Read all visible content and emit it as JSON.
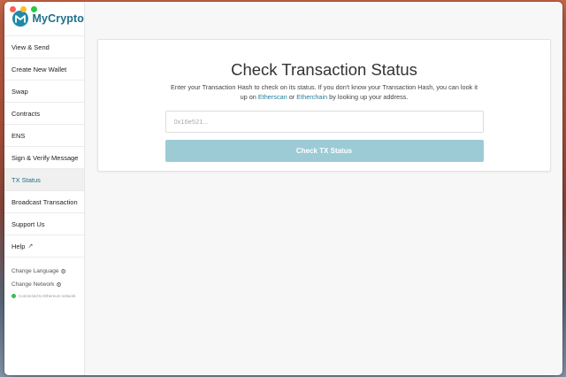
{
  "app": {
    "brand_name": "MyCrypto"
  },
  "sidebar": {
    "items": [
      {
        "label": "View & Send"
      },
      {
        "label": "Create New Wallet"
      },
      {
        "label": "Swap"
      },
      {
        "label": "Contracts"
      },
      {
        "label": "ENS"
      },
      {
        "label": "Sign & Verify Message"
      },
      {
        "label": "TX Status",
        "active": true
      },
      {
        "label": "Broadcast Transaction"
      },
      {
        "label": "Support Us"
      },
      {
        "label": "Help"
      }
    ],
    "change_language": "Change Language",
    "change_network": "Change Network",
    "network_status": "Connected to Ethereum network"
  },
  "main": {
    "title": "Check Transaction Status",
    "desc_part1": "Enter your Transaction Hash to check on its status. If you don't know your Transaction Hash, you can look it up on ",
    "etherscan_link": "Etherscan",
    "desc_or": " or ",
    "etherchain_link": "Etherchain",
    "desc_part2": " by looking up your address.",
    "input_placeholder": "0x16e521...",
    "input_value": "",
    "button_label": "Check TX Status"
  },
  "colors": {
    "accent": "#1f6f87",
    "button_disabled": "#9ccbd6",
    "status_green": "#3cb95c"
  }
}
